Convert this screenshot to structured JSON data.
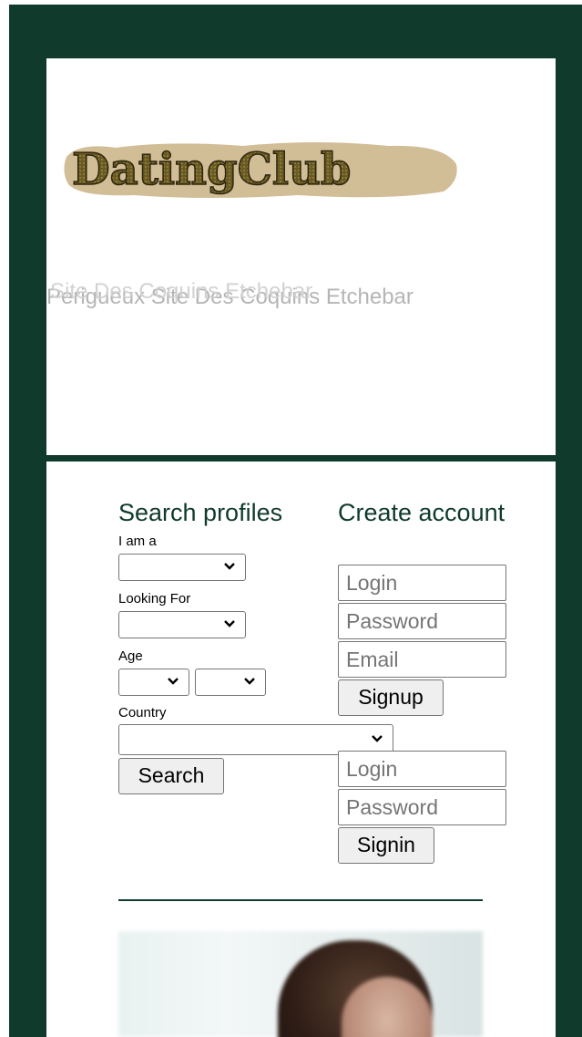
{
  "brand": {
    "logo_text": "DatingClub",
    "tagline_back": "Perigueux Site Des Coquins Etchebar",
    "tagline_front": "Site Des Coquins Etchebar"
  },
  "search": {
    "title": "Search profiles",
    "iam_label": "I am a",
    "looking_label": "Looking For",
    "age_label": "Age",
    "country_label": "Country",
    "search_button": "Search"
  },
  "signup": {
    "title": "Create account",
    "login_placeholder": "Login",
    "password_placeholder": "Password",
    "email_placeholder": "Email",
    "signup_button": "Signup"
  },
  "signin": {
    "login_placeholder": "Login",
    "password_placeholder": "Password",
    "signin_button": "Signin"
  },
  "colors": {
    "frame": "#0f3a2c",
    "heading": "#0f3a2c"
  }
}
